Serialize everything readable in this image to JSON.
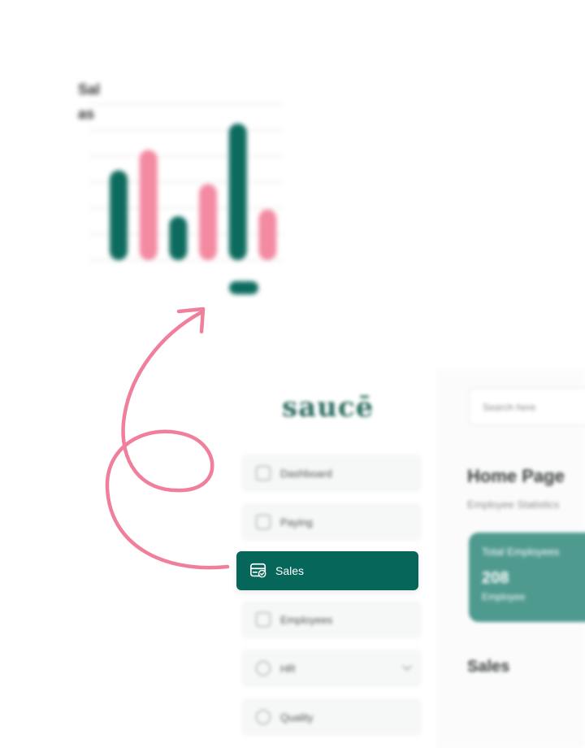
{
  "chart_preview": {
    "title_line1": "Sal",
    "title_line2": "as",
    "chart_data": {
      "type": "bar",
      "title": "",
      "categories": [
        "",
        "",
        "",
        "",
        "",
        ""
      ],
      "values": [
        92,
        113,
        45,
        78,
        140,
        52
      ],
      "ylim": [
        0,
        160
      ],
      "colors": [
        "#0d6b5e",
        "#f38aa2",
        "#0d6b5e",
        "#f38aa2",
        "#0d6b5e",
        "#f38aa2"
      ],
      "grid": true
    }
  },
  "arrow": {
    "color": "#f07f9c",
    "icon": "curly-arrow"
  },
  "app": {
    "logo": "saucē",
    "sidebar": {
      "items": [
        {
          "label": "Dashboard",
          "icon": "dashboard-icon"
        },
        {
          "label": "Paying",
          "icon": "card-icon"
        },
        {
          "label": "Sales",
          "icon": "sales-card-icon",
          "active": true
        },
        {
          "label": "Employees",
          "icon": "employees-icon"
        },
        {
          "label": "HR",
          "icon": "hr-icon",
          "has_submenu": true
        },
        {
          "label": "Quality",
          "icon": "quality-icon"
        }
      ]
    },
    "main": {
      "search_placeholder": "Search here",
      "page_title": "Home Page",
      "page_subtitle": "Employee Statistics",
      "stat_card": {
        "label": "Total Employees",
        "value": "208",
        "unit": "Employee"
      },
      "section_title": "Sales"
    },
    "colors": {
      "accent": "#056659",
      "pink": "#f38aa2",
      "card": "#4f9a8f"
    }
  }
}
